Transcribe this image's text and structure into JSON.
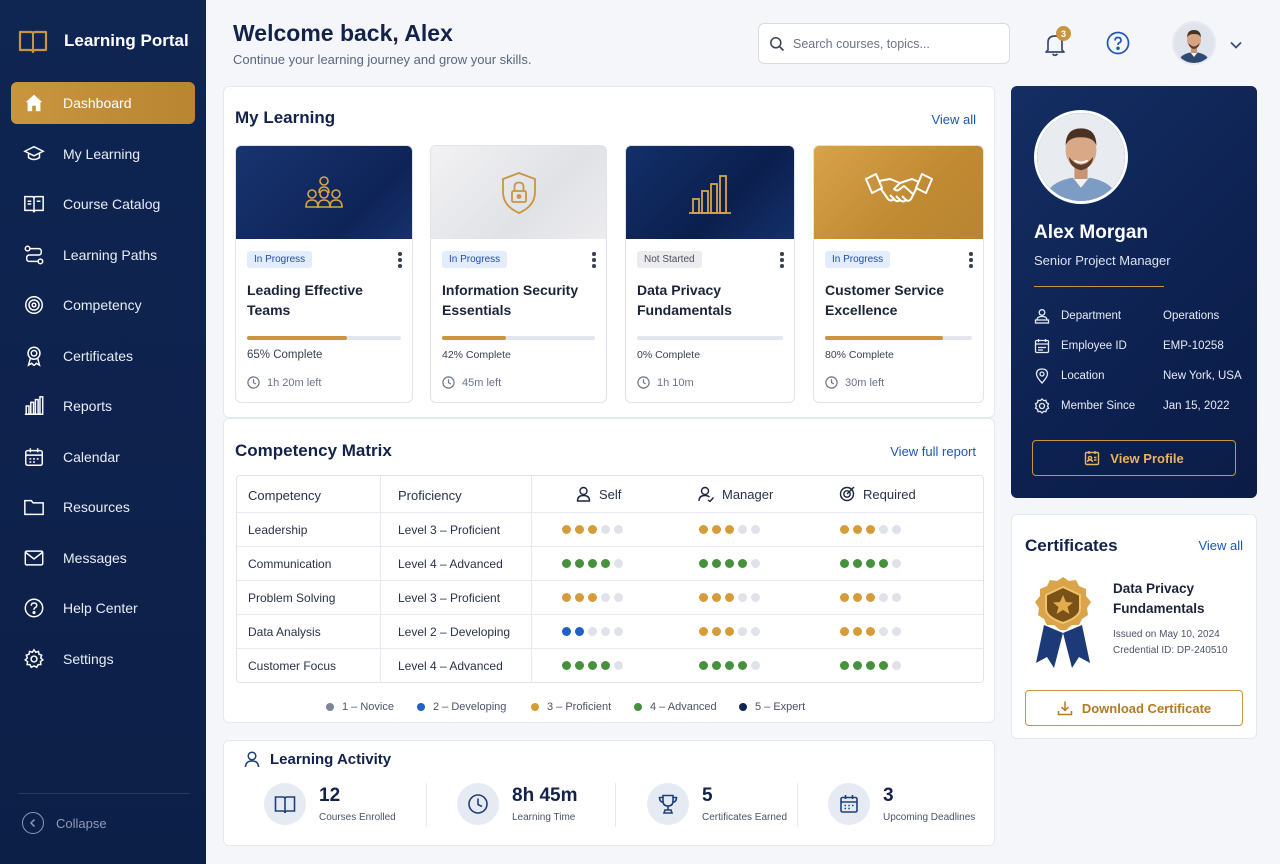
{
  "brand": {
    "title": "Learning Portal"
  },
  "nav": {
    "items": [
      {
        "label": "Dashboard"
      },
      {
        "label": "My Learning"
      },
      {
        "label": "Course Catalog"
      },
      {
        "label": "Learning Paths"
      },
      {
        "label": "Competency"
      },
      {
        "label": "Certificates"
      },
      {
        "label": "Reports"
      },
      {
        "label": "Calendar"
      },
      {
        "label": "Resources"
      },
      {
        "label": "Messages"
      },
      {
        "label": "Help Center"
      },
      {
        "label": "Settings"
      }
    ],
    "collapse_label": "Collapse"
  },
  "header": {
    "title": "Welcome back, Alex",
    "subtitle": "Continue your learning journey and grow your skills.",
    "search_placeholder": "Search courses, topics...",
    "notification_count": "3"
  },
  "my_learning": {
    "title": "My Learning",
    "view_all": "View all",
    "courses": [
      {
        "status": "In Progress",
        "title": "Leading Effective Teams",
        "progress": 65,
        "progress_text": "65% Complete",
        "time": "1h 20m left",
        "icon": "team-icon"
      },
      {
        "status": "In Progress",
        "title": "Information Security Essentials",
        "progress": 42,
        "progress_text": "42% Complete",
        "time": "45m left",
        "icon": "shield-lock-icon"
      },
      {
        "status": "Not Started",
        "title": "Data Privacy Fundamentals",
        "progress": 0,
        "progress_text": "0% Complete",
        "time": "1h 10m",
        "icon": "bar-chart-icon"
      },
      {
        "status": "In Progress",
        "title": "Customer Service Excellence",
        "progress": 80,
        "progress_text": "80% Complete",
        "time": "30m left",
        "icon": "handshake-icon"
      }
    ]
  },
  "competency": {
    "title": "Competency Matrix",
    "view_report": "View full report",
    "headers": {
      "competency": "Competency",
      "proficiency": "Proficiency",
      "self": "Self",
      "manager": "Manager",
      "required": "Required"
    },
    "rows": [
      {
        "name": "Leadership",
        "level": "Level 3 – Proficient",
        "self": 3,
        "manager": 3,
        "required": 3
      },
      {
        "name": "Communication",
        "level": "Level 4 – Advanced",
        "self": 4,
        "manager": 4,
        "required": 4
      },
      {
        "name": "Problem Solving",
        "level": "Level 3 – Proficient",
        "self": 3,
        "manager": 3,
        "required": 3
      },
      {
        "name": "Data Analysis",
        "level": "Level 2 – Developing",
        "self": 2,
        "manager": 3,
        "required": 3
      },
      {
        "name": "Customer Focus",
        "level": "Level 4 – Advanced",
        "self": 4,
        "manager": 4,
        "required": 4
      }
    ],
    "legend": [
      {
        "label": "1 – Novice",
        "color": "#7d8596"
      },
      {
        "label": "2 – Developing",
        "color": "#2160c4"
      },
      {
        "label": "3 – Proficient",
        "color": "#d69c3a"
      },
      {
        "label": "4 – Advanced",
        "color": "#46913b"
      },
      {
        "label": "5 – Expert",
        "color": "#0f2552"
      }
    ]
  },
  "activity": {
    "title": "Learning Activity",
    "stats": [
      {
        "value": "12",
        "label": "Courses Enrolled",
        "icon": "book-icon"
      },
      {
        "value": "8h 45m",
        "label": "Learning Time",
        "icon": "clock-icon"
      },
      {
        "value": "5",
        "label": "Certificates Earned",
        "icon": "trophy-icon"
      },
      {
        "value": "3",
        "label": "Upcoming Deadlines",
        "icon": "calendar-icon"
      }
    ]
  },
  "profile": {
    "name": "Alex Morgan",
    "role": "Senior Project Manager",
    "fields": [
      {
        "label": "Department",
        "value": "Operations"
      },
      {
        "label": "Employee ID",
        "value": "EMP-10258"
      },
      {
        "label": "Location",
        "value": "New York, USA"
      },
      {
        "label": "Member Since",
        "value": "Jan 15, 2022"
      }
    ],
    "button": "View Profile"
  },
  "certificates": {
    "title": "Certificates",
    "view_all": "View all",
    "name_line1": "Data Privacy",
    "name_line2": "Fundamentals",
    "issued": "Issued on May 10, 2024",
    "credential": "Credential ID: DP-240510",
    "button": "Download Certificate"
  },
  "colors": {
    "navy": "#0f2552",
    "gold": "#c9953f",
    "link": "#1f56b3"
  }
}
